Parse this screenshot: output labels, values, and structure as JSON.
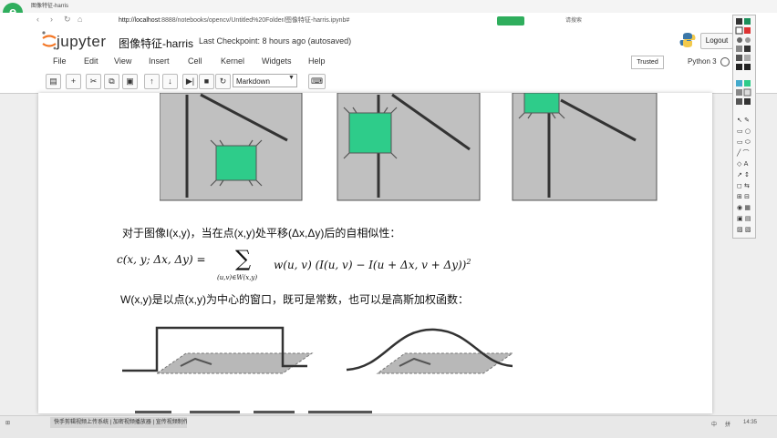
{
  "browser": {
    "tab_title": "图像特征-harris",
    "address_host": "http://localhost",
    "address_path": ":8888/notebooks/opencv/Untitled%20Folder/图像特征-harris.ipynb#",
    "search_placeholder": "请搜索"
  },
  "jupyter": {
    "logo_text": "jupyter",
    "notebook_title": "图像特征-harris",
    "checkpoint": "Last Checkpoint: 8 hours ago (autosaved)",
    "logout_label": "Logout",
    "trusted_label": "Trusted",
    "kernel_label": "Python 3"
  },
  "menu": [
    "File",
    "Edit",
    "View",
    "Insert",
    "Cell",
    "Kernel",
    "Widgets",
    "Help"
  ],
  "toolbar": {
    "icons": [
      "save-icon",
      "add-cell-icon",
      "cut-icon",
      "copy-icon",
      "paste-icon",
      "move-up-icon",
      "move-down-icon",
      "run-icon",
      "stop-icon",
      "restart-icon",
      "keyboard-icon"
    ],
    "run_glyph": "▶|",
    "cell_type": "Markdown"
  },
  "content": {
    "sentence1": "对于图像I(x,y)，当在点(x,y)处平移(Δx,Δy)后的自相似性：",
    "formula_lhs": "c(x, y; Δx, Δy) =",
    "sum_symbol": "∑",
    "sum_subscript": "(u,v)∈W(x,y)",
    "formula_rhs": "w(u, v) (I(u, v) − I(u + Δx, v + Δy))",
    "formula_exp": "2",
    "sentence2": "W(x,y)是以点(x,y)为中心的窗口，既可是常数，也可以是高斯加权函数："
  },
  "taskbar": {
    "active_task": "快手剪辑视频上传系统 | 加密视频播放器 | 宣传视频制作",
    "right_items": [
      "中",
      "拼",
      "14:35"
    ]
  },
  "colors": {
    "patch_green": "#2ecc8a",
    "image_gray": "#c0c0c0",
    "accent_green": "#2fae5d"
  }
}
